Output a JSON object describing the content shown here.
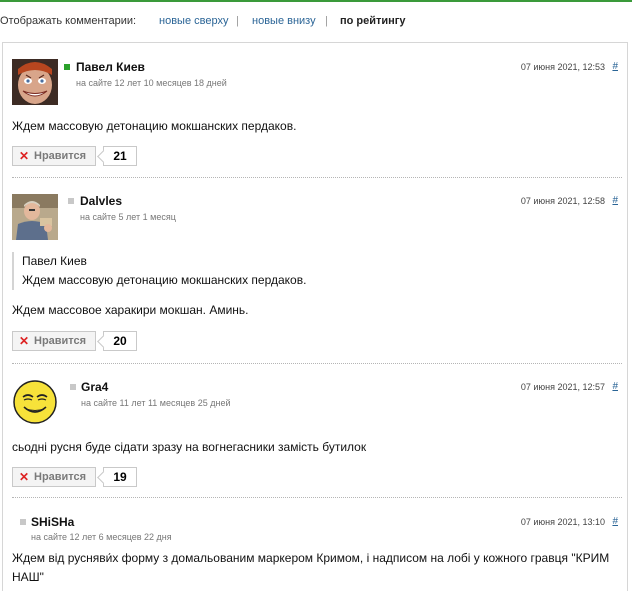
{
  "sort": {
    "label": "Отображать комментарии:",
    "options": [
      "новые сверху",
      "новые внизу",
      "по рейтингу"
    ],
    "separator": "|"
  },
  "comments": [
    {
      "author": "Павел Киев",
      "status_color": "#2aa12a",
      "since": "на сайте 12 лет 10 месяцев 18 дней",
      "date": "07 июня 2021, 12:53",
      "hash": "#",
      "text": "Ждем массовую детонацию мокшанских пердаков.",
      "like_label": "Нравится",
      "rating": "21"
    },
    {
      "author": "Dalvles",
      "status_color": "#c8c8c8",
      "since": "на сайте 5 лет 1 месяц",
      "date": "07 июня 2021, 12:58",
      "hash": "#",
      "quote_author": "Павел Киев",
      "quote_text": "Ждем массовую детонацию мокшанских пердаков.",
      "text": "Ждем массовое харакири мокшан. Аминь.",
      "like_label": "Нравится",
      "rating": "20"
    },
    {
      "author": "Gra4",
      "status_color": "#c8c8c8",
      "since": "на сайте 11 лет 11 месяцев 25 дней",
      "date": "07 июня 2021, 12:57",
      "hash": "#",
      "text": "сьодні русня буде сідати зразу на вогнегасники замість бутилок",
      "like_label": "Нравится",
      "rating": "19"
    },
    {
      "author": "SHiSHa",
      "status_color": "#c8c8c8",
      "since": "на сайте 12 лет 6 месяцев 22 дня",
      "date": "07 июня 2021, 13:10",
      "hash": "#",
      "text": "Ждем від русняви́х форму з домальованим маркером Кримом, і надписом на лобі у кожного гравця \"КРИМ НАШ\""
    }
  ]
}
